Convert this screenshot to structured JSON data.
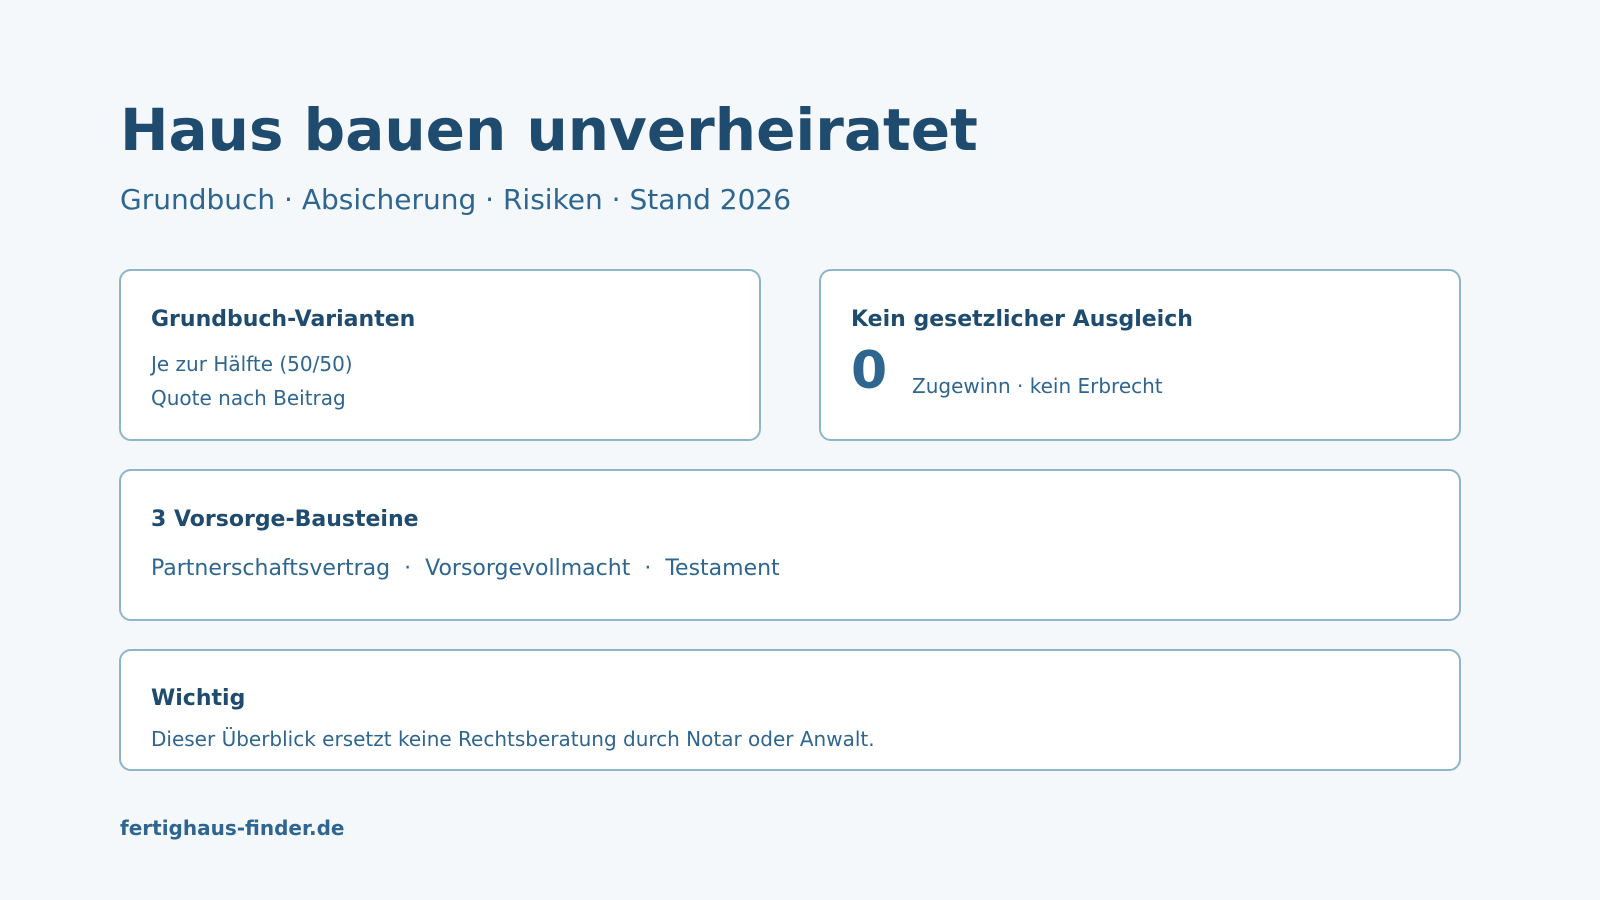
{
  "header": {
    "title": "Haus bauen unverheiratet",
    "subtitle": "Grundbuch · Absicherung · Risiken · Stand 2026"
  },
  "cards": {
    "grundbuch": {
      "title": "Grundbuch-Varianten",
      "lines": [
        "Je zur Hälfte (50/50)",
        "Quote nach Beitrag"
      ]
    },
    "ausgleich": {
      "title": "Kein gesetzlicher Ausgleich",
      "number": "0",
      "caption": "Zugewinn · kein Erbrecht"
    },
    "vorsorge": {
      "title": "3 Vorsorge-Bausteine",
      "items": [
        "Partnerschaftsvertrag",
        "Vorsorgevollmacht",
        "Testament"
      ],
      "separator": "·"
    },
    "wichtig": {
      "title": "Wichtig",
      "text": "Dieser Überblick ersetzt keine Rechtsberatung durch Notar oder Anwalt."
    }
  },
  "footer": {
    "brand": "fertighaus-finder.de"
  },
  "colors": {
    "background": "#f4f8fb",
    "title": "#1f4b6e",
    "text": "#2e6690",
    "card_border": "#8fb5cb",
    "card_background": "#ffffff"
  }
}
